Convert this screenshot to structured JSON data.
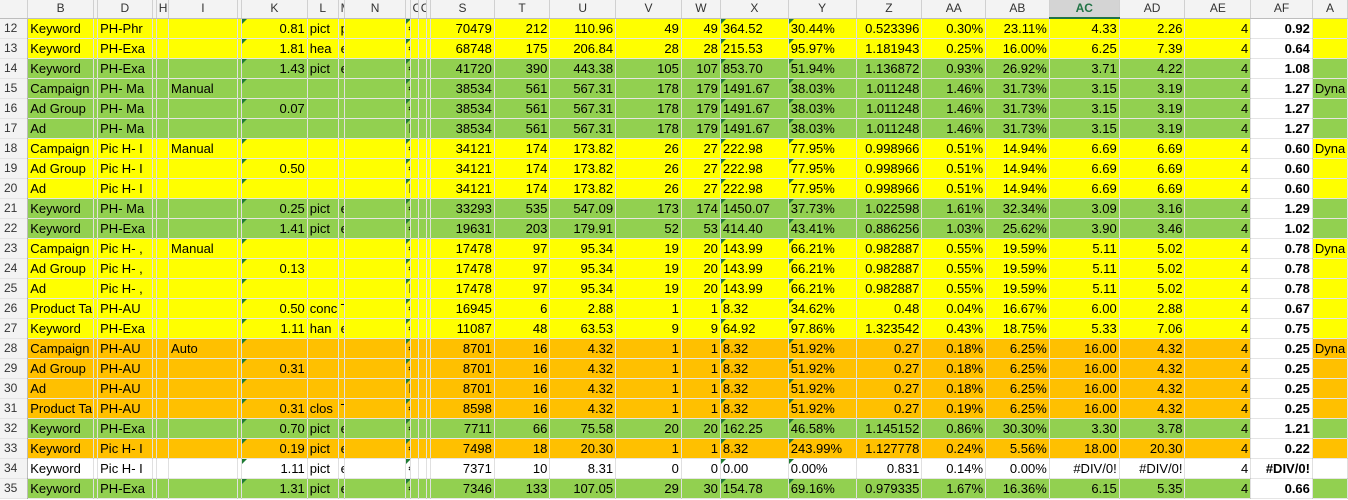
{
  "columns": [
    "B",
    "C",
    "D",
    "G",
    "H",
    "I",
    "J",
    "K",
    "L",
    "M",
    "N",
    "O",
    "P",
    "Q",
    "R",
    "S",
    "T",
    "U",
    "V",
    "W",
    "X",
    "Y",
    "Z",
    "AA",
    "AB",
    "AC",
    "AD",
    "AE",
    "AF",
    "AG"
  ],
  "column_labels": [
    "B",
    "",
    "D",
    "",
    "H",
    "I",
    "",
    "K",
    "L",
    "M",
    "N",
    "",
    "CF",
    "CF",
    "",
    "S",
    "T",
    "U",
    "V",
    "W",
    "X",
    "Y",
    "Z",
    "AA",
    "AB",
    "AC",
    "AD",
    "AE",
    "AF",
    "A"
  ],
  "selected_column": "AC",
  "rows": [
    {
      "num": "12",
      "color": "y",
      "cells": [
        "Keyword",
        "PH-Phr",
        "",
        "0.81",
        "pict",
        "phrase",
        "€€",
        "70479",
        "212",
        "110.96",
        "49",
        "49",
        "364.52",
        "30.44%",
        "0.523396",
        "0.30%",
        "23.11%",
        "4.33",
        "2.26",
        "4",
        "0.92",
        ""
      ]
    },
    {
      "num": "13",
      "color": "y",
      "cells": [
        "Keyword",
        "PH-Exa",
        "",
        "1.81",
        "hea",
        "exact",
        "€€",
        "68748",
        "175",
        "206.84",
        "28",
        "28",
        "215.53",
        "95.97%",
        "1.181943",
        "0.25%",
        "16.00%",
        "6.25",
        "7.39",
        "4",
        "0.64",
        ""
      ]
    },
    {
      "num": "14",
      "color": "g",
      "cells": [
        "Keyword",
        "PH-Exa",
        "",
        "1.43",
        "pict",
        "exact",
        "€€",
        "41720",
        "390",
        "443.38",
        "105",
        "107",
        "853.70",
        "51.94%",
        "1.136872",
        "0.93%",
        "26.92%",
        "3.71",
        "4.22",
        "4",
        "1.08",
        ""
      ]
    },
    {
      "num": "15",
      "color": "g",
      "cells": [
        "Campaign",
        "PH- Ma",
        "Manual",
        "",
        "",
        "",
        "€",
        "38534",
        "561",
        "567.31",
        "178",
        "179",
        "1491.67",
        "38.03%",
        "1.011248",
        "1.46%",
        "31.73%",
        "3.15",
        "3.19",
        "4",
        "1.27",
        "Dyna"
      ]
    },
    {
      "num": "16",
      "color": "g",
      "cells": [
        "Ad Group",
        "PH- Ma",
        "",
        "0.07",
        "",
        "",
        "€€",
        "38534",
        "561",
        "567.31",
        "178",
        "179",
        "1491.67",
        "38.03%",
        "1.011248",
        "1.46%",
        "31.73%",
        "3.15",
        "3.19",
        "4",
        "1.27",
        ""
      ]
    },
    {
      "num": "17",
      "color": "g",
      "cells": [
        "Ad",
        "PH- Ma",
        "",
        "",
        "",
        "",
        "R€€",
        "38534",
        "561",
        "567.31",
        "178",
        "179",
        "1491.67",
        "38.03%",
        "1.011248",
        "1.46%",
        "31.73%",
        "3.15",
        "3.19",
        "4",
        "1.27",
        ""
      ]
    },
    {
      "num": "18",
      "color": "y",
      "cells": [
        "Campaign",
        "Pic H- I",
        "Manual",
        "",
        "",
        "",
        "€",
        "34121",
        "174",
        "173.82",
        "26",
        "27",
        "222.98",
        "77.95%",
        "0.998966",
        "0.51%",
        "14.94%",
        "6.69",
        "6.69",
        "4",
        "0.60",
        "Dyna"
      ]
    },
    {
      "num": "19",
      "color": "y",
      "cells": [
        "Ad Group",
        "Pic H- I",
        "",
        "0.50",
        "",
        "",
        "€€",
        "34121",
        "174",
        "173.82",
        "26",
        "27",
        "222.98",
        "77.95%",
        "0.998966",
        "0.51%",
        "14.94%",
        "6.69",
        "6.69",
        "4",
        "0.60",
        ""
      ]
    },
    {
      "num": "20",
      "color": "y",
      "cells": [
        "Ad",
        "Pic H- I",
        "",
        "",
        "",
        "",
        "R€€",
        "34121",
        "174",
        "173.82",
        "26",
        "27",
        "222.98",
        "77.95%",
        "0.998966",
        "0.51%",
        "14.94%",
        "6.69",
        "6.69",
        "4",
        "0.60",
        ""
      ]
    },
    {
      "num": "21",
      "color": "g",
      "cells": [
        "Keyword",
        "PH- Ma",
        "",
        "0.25",
        "pict",
        "exact",
        "€€",
        "33293",
        "535",
        "547.09",
        "173",
        "174",
        "1450.07",
        "37.73%",
        "1.022598",
        "1.61%",
        "32.34%",
        "3.09",
        "3.16",
        "4",
        "1.29",
        ""
      ]
    },
    {
      "num": "22",
      "color": "g",
      "cells": [
        "Keyword",
        "PH-Exa",
        "",
        "1.41",
        "pict",
        "exact",
        "€€",
        "19631",
        "203",
        "179.91",
        "52",
        "53",
        "414.40",
        "43.41%",
        "0.886256",
        "1.03%",
        "25.62%",
        "3.90",
        "3.46",
        "4",
        "1.02",
        ""
      ]
    },
    {
      "num": "23",
      "color": "y",
      "cells": [
        "Campaign",
        "Pic H- ,",
        "Manual",
        "",
        "",
        "",
        "€",
        "17478",
        "97",
        "95.34",
        "19",
        "20",
        "143.99",
        "66.21%",
        "0.982887",
        "0.55%",
        "19.59%",
        "5.11",
        "5.02",
        "4",
        "0.78",
        "Dyna"
      ]
    },
    {
      "num": "24",
      "color": "y",
      "cells": [
        "Ad Group",
        "Pic H- ,",
        "",
        "0.13",
        "",
        "",
        "€€",
        "17478",
        "97",
        "95.34",
        "19",
        "20",
        "143.99",
        "66.21%",
        "0.982887",
        "0.55%",
        "19.59%",
        "5.11",
        "5.02",
        "4",
        "0.78",
        ""
      ]
    },
    {
      "num": "25",
      "color": "y",
      "cells": [
        "Ad",
        "Pic H- ,",
        "",
        "",
        "",
        "",
        "R€€",
        "17478",
        "97",
        "95.34",
        "19",
        "20",
        "143.99",
        "66.21%",
        "0.982887",
        "0.55%",
        "19.59%",
        "5.11",
        "5.02",
        "4",
        "0.78",
        ""
      ]
    },
    {
      "num": "26",
      "color": "y",
      "cells": [
        "Product Ta",
        "PH-AU",
        "",
        "0.50",
        "conc",
        "Targeting",
        "€€",
        "16945",
        "6",
        "2.88",
        "1",
        "1",
        "8.32",
        "34.62%",
        "0.48",
        "0.04%",
        "16.67%",
        "6.00",
        "2.88",
        "4",
        "0.67",
        ""
      ]
    },
    {
      "num": "27",
      "color": "y",
      "cells": [
        "Keyword",
        "PH-Exa",
        "",
        "1.11",
        "han",
        "exact",
        "€€",
        "11087",
        "48",
        "63.53",
        "9",
        "9",
        "64.92",
        "97.86%",
        "1.323542",
        "0.43%",
        "18.75%",
        "5.33",
        "7.06",
        "4",
        "0.75",
        ""
      ]
    },
    {
      "num": "28",
      "color": "o",
      "cells": [
        "Campaign",
        "PH-AU",
        "Auto",
        "",
        "",
        "",
        "€",
        "8701",
        "16",
        "4.32",
        "1",
        "1",
        "8.32",
        "51.92%",
        "0.27",
        "0.18%",
        "6.25%",
        "16.00",
        "4.32",
        "4",
        "0.25",
        "Dyna"
      ]
    },
    {
      "num": "29",
      "color": "o",
      "cells": [
        "Ad Group",
        "PH-AU",
        "",
        "0.31",
        "",
        "",
        "€€",
        "8701",
        "16",
        "4.32",
        "1",
        "1",
        "8.32",
        "51.92%",
        "0.27",
        "0.18%",
        "6.25%",
        "16.00",
        "4.32",
        "4",
        "0.25",
        ""
      ]
    },
    {
      "num": "30",
      "color": "o",
      "cells": [
        "Ad",
        "PH-AU",
        "",
        "",
        "",
        "",
        "R€€",
        "8701",
        "16",
        "4.32",
        "1",
        "1",
        "8.32",
        "51.92%",
        "0.27",
        "0.18%",
        "6.25%",
        "16.00",
        "4.32",
        "4",
        "0.25",
        ""
      ]
    },
    {
      "num": "31",
      "color": "o",
      "cells": [
        "Product Ta",
        "PH-AU",
        "",
        "0.31",
        "clos",
        "Targeting",
        "€€",
        "8598",
        "16",
        "4.32",
        "1",
        "1",
        "8.32",
        "51.92%",
        "0.27",
        "0.19%",
        "6.25%",
        "16.00",
        "4.32",
        "4",
        "0.25",
        ""
      ]
    },
    {
      "num": "32",
      "color": "g",
      "cells": [
        "Keyword",
        "PH-Exa",
        "",
        "0.70",
        "pict",
        "exact",
        "€€",
        "7711",
        "66",
        "75.58",
        "20",
        "20",
        "162.25",
        "46.58%",
        "1.145152",
        "0.86%",
        "30.30%",
        "3.30",
        "3.78",
        "4",
        "1.21",
        ""
      ]
    },
    {
      "num": "33",
      "color": "o",
      "cells": [
        "Keyword",
        "Pic H- I",
        "",
        "0.19",
        "pict",
        "exact",
        "€€",
        "7498",
        "18",
        "20.30",
        "1",
        "1",
        "8.32",
        "243.99%",
        "1.127778",
        "0.24%",
        "5.56%",
        "18.00",
        "20.30",
        "4",
        "0.22",
        ""
      ]
    },
    {
      "num": "34",
      "color": "w",
      "cells": [
        "Keyword",
        "Pic H- I",
        "",
        "1.11",
        "pict",
        "exact",
        "€€",
        "7371",
        "10",
        "8.31",
        "0",
        "0",
        "0.00",
        "0.00%",
        "0.831",
        "0.14%",
        "0.00%",
        "#DIV/0!",
        "#DIV/0!",
        "4",
        "#DIV/0!",
        ""
      ]
    },
    {
      "num": "35",
      "color": "g",
      "cells": [
        "Keyword",
        "PH-Exa",
        "",
        "1.31",
        "pict",
        "exact",
        "€€",
        "7346",
        "133",
        "107.05",
        "29",
        "30",
        "154.78",
        "69.16%",
        "0.979335",
        "1.67%",
        "16.36%",
        "6.15",
        "5.35",
        "4",
        "0.66",
        ""
      ]
    }
  ],
  "colors": {
    "yellow": "#ffff00",
    "green": "#92d050",
    "orange": "#ffc000",
    "selected_header": "#217346"
  }
}
